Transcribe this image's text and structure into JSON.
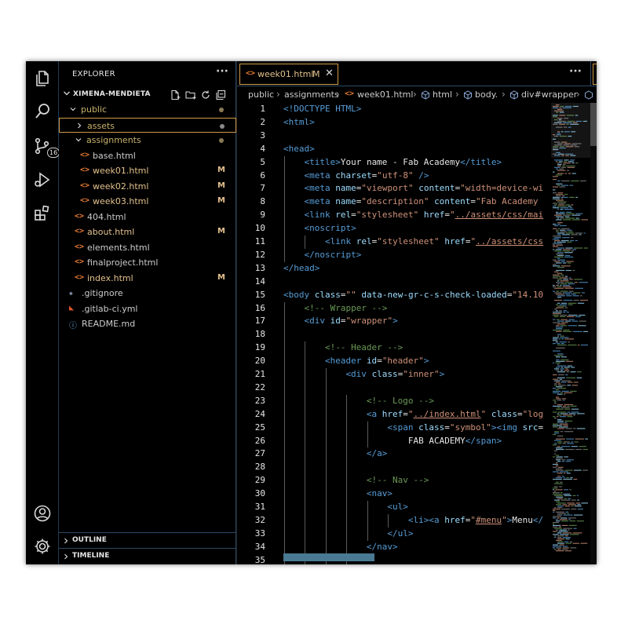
{
  "activity_bar": {
    "items": [
      {
        "icon": "files-icon"
      },
      {
        "icon": "search-icon"
      },
      {
        "icon": "source-control-icon",
        "badge": "16"
      },
      {
        "icon": "run-debug-icon"
      },
      {
        "icon": "extensions-icon"
      }
    ],
    "bottom": [
      {
        "icon": "account-icon"
      },
      {
        "icon": "settings-gear-icon"
      }
    ]
  },
  "sidebar": {
    "title": "EXPLORER",
    "more": "···",
    "root_label": "XIMENA-MENDIETA",
    "tree": [
      {
        "label": "public",
        "type": "folder-open",
        "depth": 1,
        "color": "#c8b26a",
        "status": "dot"
      },
      {
        "label": "assets",
        "type": "folder-closed",
        "depth": 2,
        "color": "#c8b26a",
        "status": "dot",
        "selected": true
      },
      {
        "label": "assignments",
        "type": "folder-open",
        "depth": 2,
        "color": "#c8b26a",
        "status": "dot"
      },
      {
        "label": "base.html",
        "type": "html",
        "depth": 3,
        "color": "#cccccc",
        "status": ""
      },
      {
        "label": "week01.html",
        "type": "html",
        "depth": 3,
        "color": "#e2c08d",
        "status": "M"
      },
      {
        "label": "week02.html",
        "type": "html",
        "depth": 3,
        "color": "#e2c08d",
        "status": "M"
      },
      {
        "label": "week03.html",
        "type": "html",
        "depth": 3,
        "color": "#e2c08d",
        "status": "M"
      },
      {
        "label": "404.html",
        "type": "html",
        "depth": 2,
        "color": "#cccccc",
        "status": ""
      },
      {
        "label": "about.html",
        "type": "html",
        "depth": 2,
        "color": "#e2c08d",
        "status": "M"
      },
      {
        "label": "elements.html",
        "type": "html",
        "depth": 2,
        "color": "#cccccc",
        "status": ""
      },
      {
        "label": "finalproject.html",
        "type": "html",
        "depth": 2,
        "color": "#cccccc",
        "status": ""
      },
      {
        "label": "index.html",
        "type": "html",
        "depth": 2,
        "color": "#e2c08d",
        "status": "M"
      },
      {
        "label": ".gitignore",
        "type": "gitignore",
        "depth": 1,
        "color": "#cccccc",
        "status": ""
      },
      {
        "label": ".gitlab-ci.yml",
        "type": "gitlab",
        "depth": 1,
        "color": "#cccccc",
        "status": ""
      },
      {
        "label": "README.md",
        "type": "info",
        "depth": 1,
        "color": "#cccccc",
        "status": ""
      }
    ],
    "outline_label": "OUTLINE",
    "timeline_label": "TIMELINE"
  },
  "editor": {
    "tab": {
      "label": "week01.html",
      "modified": "M",
      "close": "✕"
    },
    "more": "···",
    "breadcrumb": [
      "public",
      "assignments",
      "week01.html",
      "html",
      "body.",
      "div#wrapper"
    ],
    "lines": [
      {
        "n": "1",
        "indent": 0,
        "tokens": [
          [
            "tag",
            "<!DOCTYPE HTML>"
          ]
        ]
      },
      {
        "n": "2",
        "indent": 0,
        "tokens": [
          [
            "tag",
            "<html>"
          ]
        ]
      },
      {
        "n": "3",
        "indent": 0,
        "tokens": []
      },
      {
        "n": "4",
        "indent": 0,
        "tokens": [
          [
            "tag",
            "<head>"
          ]
        ]
      },
      {
        "n": "5",
        "indent": 1,
        "tokens": [
          [
            "tag",
            "<title>"
          ],
          [
            "txt",
            "Your name - Fab Academy"
          ],
          [
            "tag",
            "</title>"
          ]
        ]
      },
      {
        "n": "6",
        "indent": 1,
        "tokens": [
          [
            "tag",
            "<meta "
          ],
          [
            "attr",
            "charset"
          ],
          [
            "txt",
            "="
          ],
          [
            "str",
            "\"utf-8\""
          ],
          [
            "txt",
            " "
          ],
          [
            "tag",
            "/>"
          ]
        ]
      },
      {
        "n": "7",
        "indent": 1,
        "tokens": [
          [
            "tag",
            "<meta "
          ],
          [
            "attr",
            "name"
          ],
          [
            "txt",
            "="
          ],
          [
            "str",
            "\"viewport\""
          ],
          [
            "txt",
            " "
          ],
          [
            "attr",
            "content"
          ],
          [
            "txt",
            "="
          ],
          [
            "str",
            "\"width=device-wi"
          ]
        ]
      },
      {
        "n": "8",
        "indent": 1,
        "tokens": [
          [
            "tag",
            "<meta "
          ],
          [
            "attr",
            "name"
          ],
          [
            "txt",
            "="
          ],
          [
            "str",
            "\"description\""
          ],
          [
            "txt",
            " "
          ],
          [
            "attr",
            "content"
          ],
          [
            "txt",
            "="
          ],
          [
            "str",
            "\"Fab Academy"
          ]
        ]
      },
      {
        "n": "9",
        "indent": 1,
        "tokens": [
          [
            "tag",
            "<link "
          ],
          [
            "attr",
            "rel"
          ],
          [
            "txt",
            "="
          ],
          [
            "str",
            "\"stylesheet\""
          ],
          [
            "txt",
            " "
          ],
          [
            "attr",
            "href"
          ],
          [
            "txt",
            "="
          ],
          [
            "str",
            "\""
          ],
          [
            "und",
            "../assets/css/mai"
          ]
        ]
      },
      {
        "n": "10",
        "indent": 1,
        "tokens": [
          [
            "tag",
            "<noscript>"
          ]
        ]
      },
      {
        "n": "11",
        "indent": 2,
        "tokens": [
          [
            "tag",
            "<link "
          ],
          [
            "attr",
            "rel"
          ],
          [
            "txt",
            "="
          ],
          [
            "str",
            "\"stylesheet\""
          ],
          [
            "txt",
            " "
          ],
          [
            "attr",
            "href"
          ],
          [
            "txt",
            "="
          ],
          [
            "str",
            "\""
          ],
          [
            "und",
            "../assets/css"
          ]
        ]
      },
      {
        "n": "12",
        "indent": 1,
        "tokens": [
          [
            "tag",
            "</noscript>"
          ]
        ]
      },
      {
        "n": "13",
        "indent": 0,
        "tokens": [
          [
            "tag",
            "</head>"
          ]
        ]
      },
      {
        "n": "14",
        "indent": 0,
        "tokens": []
      },
      {
        "n": "15",
        "indent": 0,
        "tokens": [
          [
            "tag",
            "<body "
          ],
          [
            "attr",
            "class"
          ],
          [
            "txt",
            "="
          ],
          [
            "str",
            "\"\""
          ],
          [
            "txt",
            " "
          ],
          [
            "attr",
            "data-new-gr-c-s-check-loaded"
          ],
          [
            "txt",
            "="
          ],
          [
            "str",
            "\"14.10"
          ]
        ]
      },
      {
        "n": "16",
        "indent": 1,
        "tokens": [
          [
            "com",
            "<!-- Wrapper -->"
          ]
        ]
      },
      {
        "n": "17",
        "indent": 1,
        "tokens": [
          [
            "tag",
            "<div "
          ],
          [
            "attr",
            "id"
          ],
          [
            "txt",
            "="
          ],
          [
            "str",
            "\"wrapper\""
          ],
          [
            "tag",
            ">"
          ]
        ]
      },
      {
        "n": "18",
        "indent": 0,
        "tokens": []
      },
      {
        "n": "19",
        "indent": 2,
        "tokens": [
          [
            "com",
            "<!-- Header -->"
          ]
        ]
      },
      {
        "n": "20",
        "indent": 2,
        "tokens": [
          [
            "tag",
            "<header "
          ],
          [
            "attr",
            "id"
          ],
          [
            "txt",
            "="
          ],
          [
            "str",
            "\"header\""
          ],
          [
            "tag",
            ">"
          ]
        ]
      },
      {
        "n": "21",
        "indent": 3,
        "tokens": [
          [
            "tag",
            "<div "
          ],
          [
            "attr",
            "class"
          ],
          [
            "txt",
            "="
          ],
          [
            "str",
            "\"inner\""
          ],
          [
            "tag",
            ">"
          ]
        ]
      },
      {
        "n": "22",
        "indent": 0,
        "tokens": []
      },
      {
        "n": "23",
        "indent": 4,
        "tokens": [
          [
            "com",
            "<!-- Logo -->"
          ]
        ]
      },
      {
        "n": "24",
        "indent": 4,
        "tokens": [
          [
            "tag",
            "<a "
          ],
          [
            "attr",
            "href"
          ],
          [
            "txt",
            "="
          ],
          [
            "str",
            "\""
          ],
          [
            "und",
            "../index.html"
          ],
          [
            "str",
            "\""
          ],
          [
            "txt",
            " "
          ],
          [
            "attr",
            "class"
          ],
          [
            "txt",
            "="
          ],
          [
            "str",
            "\"log"
          ]
        ]
      },
      {
        "n": "25",
        "indent": 5,
        "tokens": [
          [
            "tag",
            "<span "
          ],
          [
            "attr",
            "class"
          ],
          [
            "txt",
            "="
          ],
          [
            "str",
            "\"symbol\""
          ],
          [
            "tag",
            "><img "
          ],
          [
            "attr",
            "src"
          ],
          [
            "txt",
            "="
          ]
        ]
      },
      {
        "n": "26",
        "indent": 6,
        "tokens": [
          [
            "txt",
            "FAB ACADEMY"
          ],
          [
            "tag",
            "</span>"
          ]
        ]
      },
      {
        "n": "27",
        "indent": 4,
        "tokens": [
          [
            "tag",
            "</a>"
          ]
        ]
      },
      {
        "n": "28",
        "indent": 0,
        "tokens": []
      },
      {
        "n": "29",
        "indent": 4,
        "tokens": [
          [
            "com",
            "<!-- Nav -->"
          ]
        ]
      },
      {
        "n": "30",
        "indent": 4,
        "tokens": [
          [
            "tag",
            "<nav>"
          ]
        ]
      },
      {
        "n": "31",
        "indent": 5,
        "tokens": [
          [
            "tag",
            "<ul>"
          ]
        ]
      },
      {
        "n": "32",
        "indent": 6,
        "tokens": [
          [
            "tag",
            "<li><a "
          ],
          [
            "attr",
            "href"
          ],
          [
            "txt",
            "="
          ],
          [
            "str",
            "\""
          ],
          [
            "und",
            "#menu"
          ],
          [
            "str",
            "\""
          ],
          [
            "tag",
            ">"
          ],
          [
            "txt",
            "Menu"
          ],
          [
            "tag",
            "</"
          ]
        ]
      },
      {
        "n": "33",
        "indent": 5,
        "tokens": [
          [
            "tag",
            "</ul>"
          ]
        ]
      },
      {
        "n": "34",
        "indent": 4,
        "tokens": [
          [
            "tag",
            "</nav>"
          ]
        ]
      },
      {
        "n": "35",
        "indent": 0,
        "tokens": []
      }
    ]
  },
  "colors": {
    "accent_border": "#d19a4a",
    "modified": "#e2c08d",
    "folder": "#c8b26a",
    "html_icon": "#e37933"
  }
}
